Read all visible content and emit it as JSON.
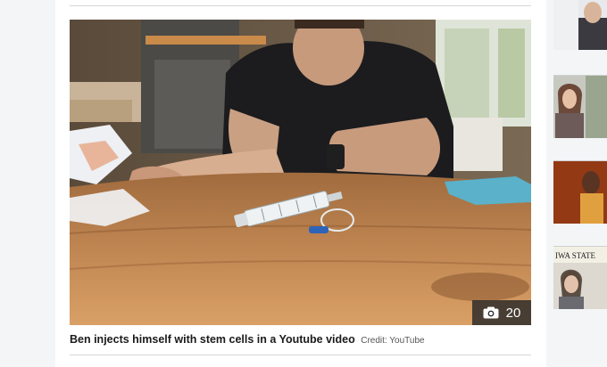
{
  "article": {
    "media": {
      "type": "video-still",
      "gallery_count": "20",
      "icon": "camera-icon"
    },
    "caption": {
      "text": "Ben injects himself with stem cells in a Youtube video",
      "credit": "Credit: YouTube"
    }
  },
  "sidebar": {
    "thumbnails": [
      {
        "icon": "news-thumbnail"
      },
      {
        "icon": "news-thumbnail"
      },
      {
        "icon": "news-thumbnail"
      },
      {
        "icon": "news-thumbnail",
        "text": "IWA STATE"
      }
    ]
  }
}
